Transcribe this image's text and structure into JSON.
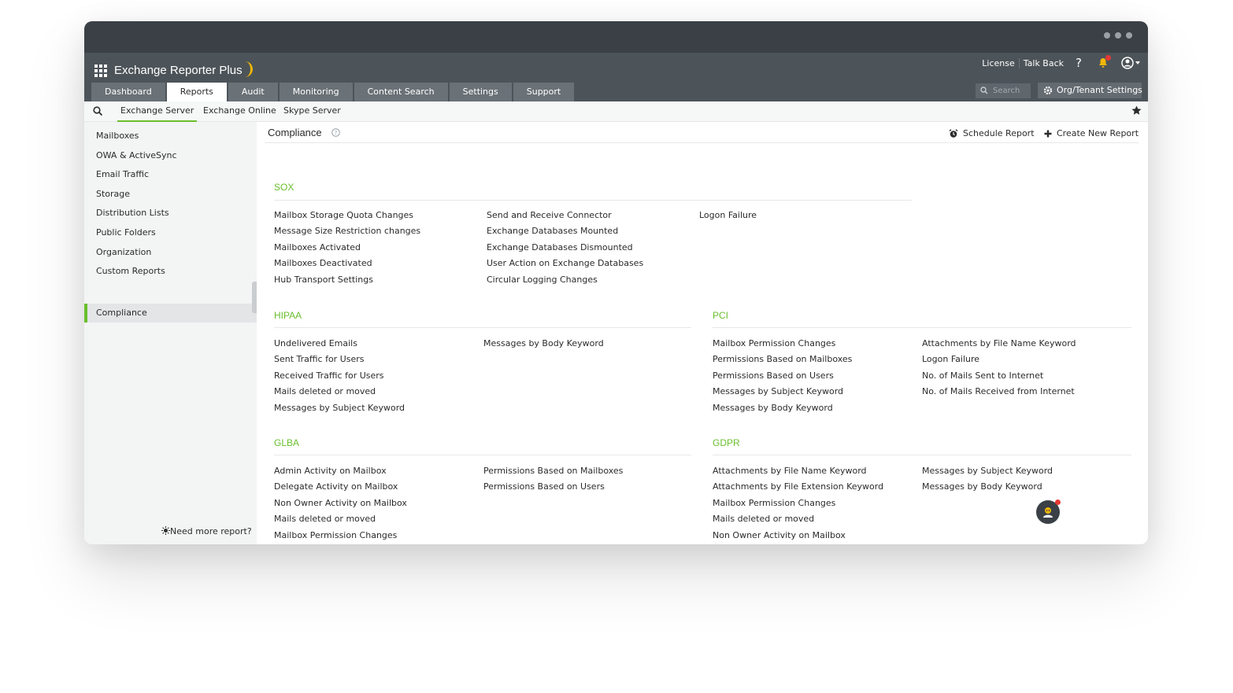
{
  "app": {
    "title": "Exchange Reporter Plus"
  },
  "toplinks": {
    "license": "License",
    "talkback": "Talk Back",
    "help": "?"
  },
  "tabs": [
    {
      "label": "Dashboard"
    },
    {
      "label": "Reports"
    },
    {
      "label": "Audit"
    },
    {
      "label": "Monitoring"
    },
    {
      "label": "Content Search"
    },
    {
      "label": "Settings"
    },
    {
      "label": "Support"
    }
  ],
  "search": {
    "placeholder": "Search"
  },
  "org_settings": {
    "label": "Org/Tenant Settings"
  },
  "subtabs": [
    {
      "label": "Exchange Server"
    },
    {
      "label": "Exchange Online"
    },
    {
      "label": "Skype Server"
    }
  ],
  "sidebar": {
    "items": [
      {
        "label": "Mailboxes"
      },
      {
        "label": "OWA & ActiveSync"
      },
      {
        "label": "Email Traffic"
      },
      {
        "label": "Storage"
      },
      {
        "label": "Distribution Lists"
      },
      {
        "label": "Public Folders"
      },
      {
        "label": "Organization"
      },
      {
        "label": "Custom Reports"
      },
      {
        "label": "Compliance"
      }
    ],
    "need_more": "Need more report?"
  },
  "main": {
    "title": "Compliance",
    "schedule": "Schedule Report",
    "create": "Create New Report",
    "sections": {
      "sox": {
        "title": "SOX",
        "col1": [
          "Mailbox Storage Quota Changes",
          "Message Size Restriction changes",
          "Mailboxes Activated",
          "Mailboxes Deactivated",
          "Hub Transport Settings"
        ],
        "col2": [
          "Send and Receive Connector",
          "Exchange Databases Mounted",
          "Exchange Databases Dismounted",
          "User Action on Exchange Databases",
          "Circular Logging Changes"
        ],
        "col3": [
          "Logon Failure"
        ]
      },
      "hipaa": {
        "title": "HIPAA",
        "col1": [
          "Undelivered Emails",
          "Sent Traffic for Users",
          "Received Traffic for Users",
          "Mails deleted or moved",
          "Messages by Subject Keyword"
        ],
        "col2": [
          "Messages by Body Keyword"
        ]
      },
      "pci": {
        "title": "PCI",
        "col1": [
          "Mailbox Permission Changes",
          "Permissions Based on Mailboxes",
          "Permissions Based on Users",
          "Messages by Subject Keyword",
          "Messages by Body Keyword"
        ],
        "col2": [
          "Attachments by File Name Keyword",
          "Logon Failure",
          "No. of Mails Sent to Internet",
          "No. of Mails Received from Internet"
        ]
      },
      "glba": {
        "title": "GLBA",
        "col1": [
          "Admin Activity on Mailbox",
          "Delegate Activity on Mailbox",
          "Non Owner Activity on Mailbox",
          "Mails deleted or moved",
          "Mailbox Permission Changes"
        ],
        "col2": [
          "Permissions Based on Mailboxes",
          "Permissions Based on Users"
        ]
      },
      "gdpr": {
        "title": "GDPR",
        "col1": [
          "Attachments by File Name Keyword",
          "Attachments by File Extension Keyword",
          "Mailbox Permission Changes",
          "Mails deleted or moved",
          "Non Owner Activity on Mailbox"
        ],
        "col2": [
          "Messages by Subject Keyword",
          "Messages by Body Keyword"
        ]
      }
    }
  },
  "colors": {
    "accent": "#6abf2d",
    "header": "#4d5459",
    "titlebar": "#3a4046"
  }
}
